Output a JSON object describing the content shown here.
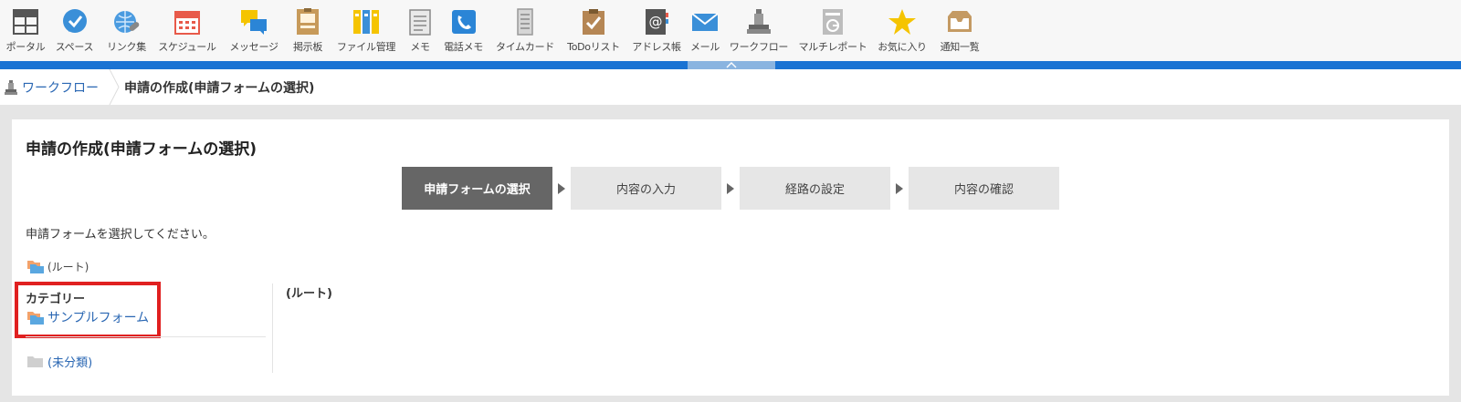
{
  "apps": [
    {
      "label": "ポータル",
      "icon": "portal-icon",
      "width": 50
    },
    {
      "label": "スペース",
      "icon": "space-icon",
      "width": 57
    },
    {
      "label": "リンク集",
      "icon": "link-icon",
      "width": 57
    },
    {
      "label": "スケジュール",
      "icon": "schedule-icon",
      "width": 76
    },
    {
      "label": "メッセージ",
      "icon": "message-icon",
      "width": 70
    },
    {
      "label": "掲示板",
      "icon": "bulletin-icon",
      "width": 48
    },
    {
      "label": "ファイル管理",
      "icon": "file-icon",
      "width": 80
    },
    {
      "label": "メモ",
      "icon": "memo-icon",
      "width": 38
    },
    {
      "label": "電話メモ",
      "icon": "phone-memo-icon",
      "width": 57
    },
    {
      "label": "タイムカード",
      "icon": "timecard-icon",
      "width": 78
    },
    {
      "label": "ToDoリスト",
      "icon": "todo-icon",
      "width": 72
    },
    {
      "label": "アドレス帳",
      "icon": "address-icon",
      "width": 66
    },
    {
      "label": "メール",
      "icon": "mail-icon",
      "width": 40
    },
    {
      "label": "ワークフロー",
      "icon": "workflow-icon",
      "width": 78
    },
    {
      "label": "マルチレポート",
      "icon": "multireport-icon",
      "width": 84
    },
    {
      "label": "お気に入り",
      "icon": "favorite-icon",
      "width": 68
    },
    {
      "label": "通知一覧",
      "icon": "notification-icon",
      "width": 58
    }
  ],
  "breadcrumb": {
    "link": "ワークフロー",
    "current": "申請の作成(申請フォームの選択)"
  },
  "page": {
    "title": "申請の作成(申請フォームの選択)",
    "instruction": "申請フォームを選択してください。"
  },
  "steps": [
    {
      "label": "申請フォームの選択",
      "active": true
    },
    {
      "label": "内容の入力",
      "active": false
    },
    {
      "label": "経路の設定",
      "active": false
    },
    {
      "label": "内容の確認",
      "active": false
    }
  ],
  "tree": {
    "root": "(ルート)",
    "category_title": "カテゴリー",
    "category_item": "サンプルフォーム",
    "uncategorized": "(未分類)"
  },
  "right": {
    "title": "(ルート)"
  },
  "colors": {
    "accent_blue": "#1a73d3",
    "link": "#2a67b3",
    "highlight": "#e02020",
    "active_step": "#666666"
  }
}
